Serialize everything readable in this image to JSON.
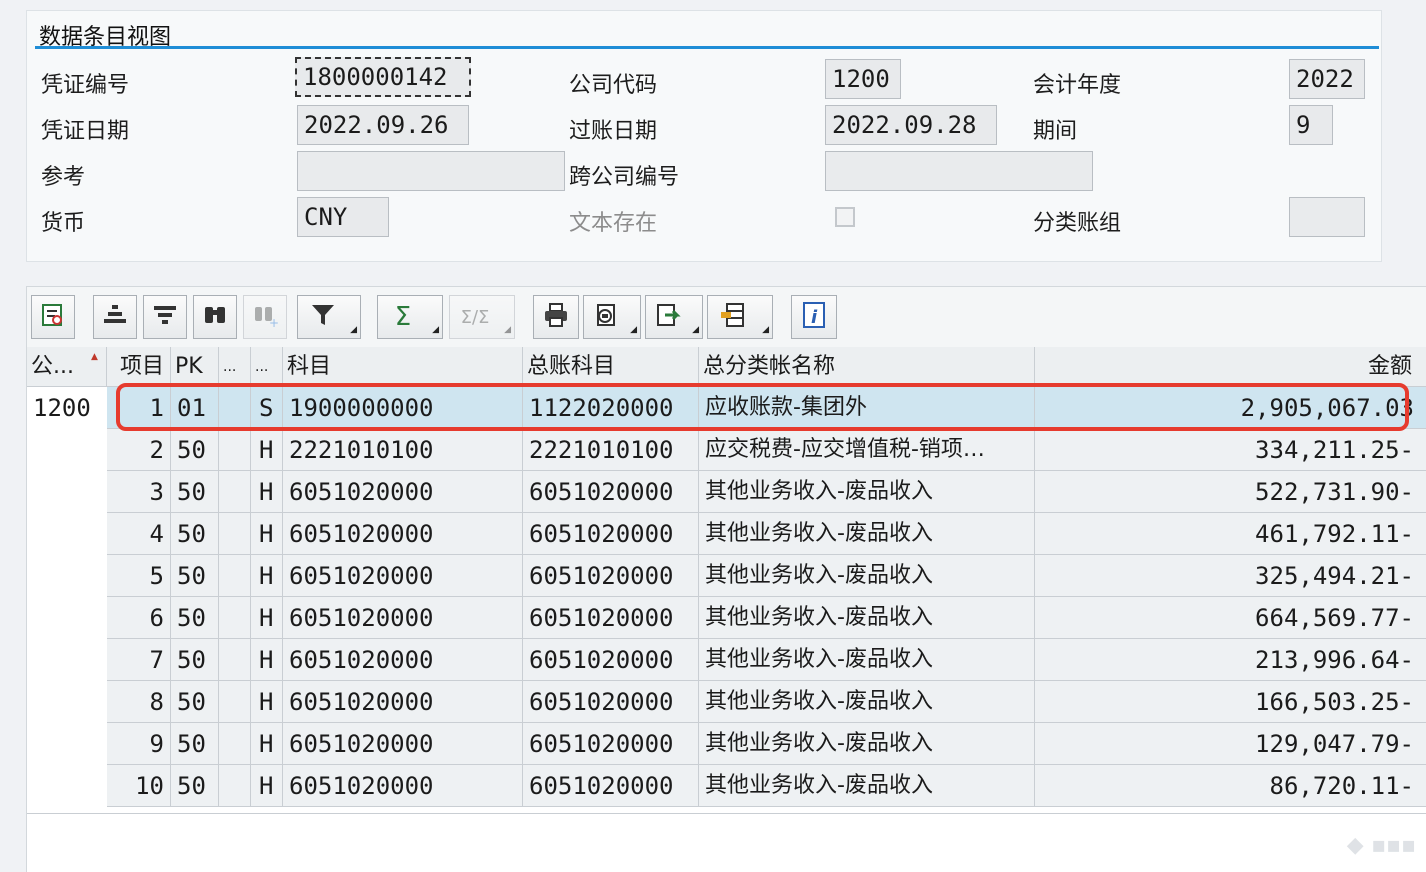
{
  "panel": {
    "title": "数据条目视图"
  },
  "fields": {
    "doc_number": {
      "label": "凭证编号",
      "value": "1800000142"
    },
    "company_code": {
      "label": "公司代码",
      "value": "1200"
    },
    "fiscal_year": {
      "label": "会计年度",
      "value": "2022"
    },
    "doc_date": {
      "label": "凭证日期",
      "value": "2022.09.26"
    },
    "posting_date": {
      "label": "过账日期",
      "value": "2022.09.28"
    },
    "period": {
      "label": "期间",
      "value": "9"
    },
    "reference": {
      "label": "参考",
      "value": ""
    },
    "cross_company": {
      "label": "跨公司编号",
      "value": ""
    },
    "currency": {
      "label": "货币",
      "value": "CNY"
    },
    "text_exists": {
      "label": "文本存在",
      "checked": false
    },
    "ledger_group": {
      "label": "分类账组",
      "value": ""
    }
  },
  "toolbar": {
    "buttons": [
      {
        "icon": "details-icon"
      },
      {
        "icon": "sort-ascending-icon"
      },
      {
        "icon": "sort-descending-icon"
      },
      {
        "icon": "find-icon"
      },
      {
        "icon": "find-next-icon",
        "disabled": true
      },
      {
        "icon": "filter-icon",
        "dropdown": true
      },
      {
        "icon": "sum-icon",
        "dropdown": true
      },
      {
        "icon": "subtotal-icon",
        "dropdown": true,
        "disabled": true
      },
      {
        "icon": "print-icon"
      },
      {
        "icon": "view-icon",
        "dropdown": true
      },
      {
        "icon": "export-icon",
        "dropdown": true
      },
      {
        "icon": "layout-icon",
        "dropdown": true
      },
      {
        "icon": "info-icon"
      }
    ]
  },
  "table": {
    "columns": [
      "公...",
      "项目",
      "PK",
      "...",
      "...",
      "科目",
      "总账科目",
      "总分类帐名称",
      "金额"
    ],
    "company_code_value": "1200",
    "rows": [
      {
        "item": "1",
        "pk": "01",
        "dc": "S",
        "account": "1900000000",
        "gl": "1122020000",
        "gl_name": "应收账款-集团外",
        "amount": "2,905,067.03"
      },
      {
        "item": "2",
        "pk": "50",
        "dc": "H",
        "account": "2221010100",
        "gl": "2221010100",
        "gl_name": "应交税费-应交增值税-销项…",
        "amount": "334,211.25-"
      },
      {
        "item": "3",
        "pk": "50",
        "dc": "H",
        "account": "6051020000",
        "gl": "6051020000",
        "gl_name": "其他业务收入-废品收入",
        "amount": "522,731.90-"
      },
      {
        "item": "4",
        "pk": "50",
        "dc": "H",
        "account": "6051020000",
        "gl": "6051020000",
        "gl_name": "其他业务收入-废品收入",
        "amount": "461,792.11-"
      },
      {
        "item": "5",
        "pk": "50",
        "dc": "H",
        "account": "6051020000",
        "gl": "6051020000",
        "gl_name": "其他业务收入-废品收入",
        "amount": "325,494.21-"
      },
      {
        "item": "6",
        "pk": "50",
        "dc": "H",
        "account": "6051020000",
        "gl": "6051020000",
        "gl_name": "其他业务收入-废品收入",
        "amount": "664,569.77-"
      },
      {
        "item": "7",
        "pk": "50",
        "dc": "H",
        "account": "6051020000",
        "gl": "6051020000",
        "gl_name": "其他业务收入-废品收入",
        "amount": "213,996.64-"
      },
      {
        "item": "8",
        "pk": "50",
        "dc": "H",
        "account": "6051020000",
        "gl": "6051020000",
        "gl_name": "其他业务收入-废品收入",
        "amount": "166,503.25-"
      },
      {
        "item": "9",
        "pk": "50",
        "dc": "H",
        "account": "6051020000",
        "gl": "6051020000",
        "gl_name": "其他业务收入-废品收入",
        "amount": "129,047.79-"
      },
      {
        "item": "10",
        "pk": "50",
        "dc": "H",
        "account": "6051020000",
        "gl": "6051020000",
        "gl_name": "其他业务收入-废品收入",
        "amount": "86,720.11-"
      }
    ]
  },
  "colors": {
    "accent": "#1f8dd6",
    "highlight": "#e63b2e",
    "selected_row": "#cfe5f0"
  }
}
